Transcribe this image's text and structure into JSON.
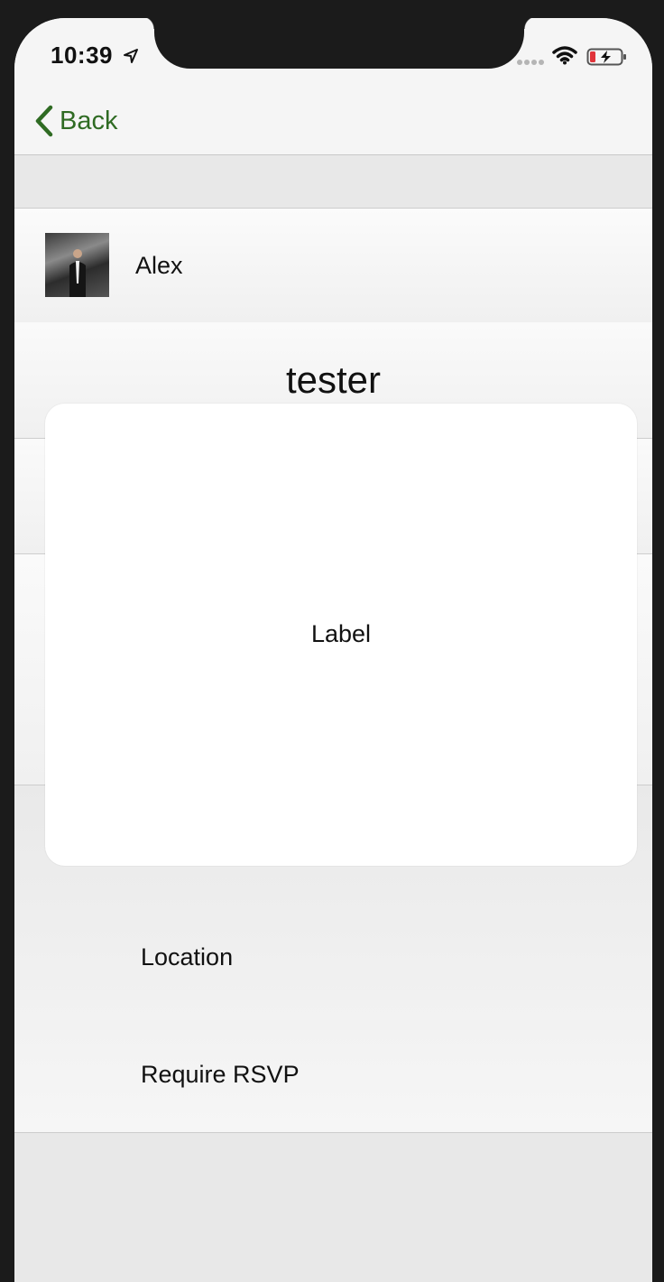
{
  "status_bar": {
    "time": "10:39",
    "icons": [
      "location-arrow-icon",
      "signal-dots-icon",
      "wifi-icon",
      "battery-charging-icon"
    ]
  },
  "nav": {
    "back_label": "Back",
    "accent_color": "#2f6b23"
  },
  "host": {
    "name": "Alex"
  },
  "event": {
    "title": "tester"
  },
  "fields": {
    "location_label": "Location",
    "rsvp_label": "Require RSVP"
  },
  "modal": {
    "label": "Label"
  }
}
